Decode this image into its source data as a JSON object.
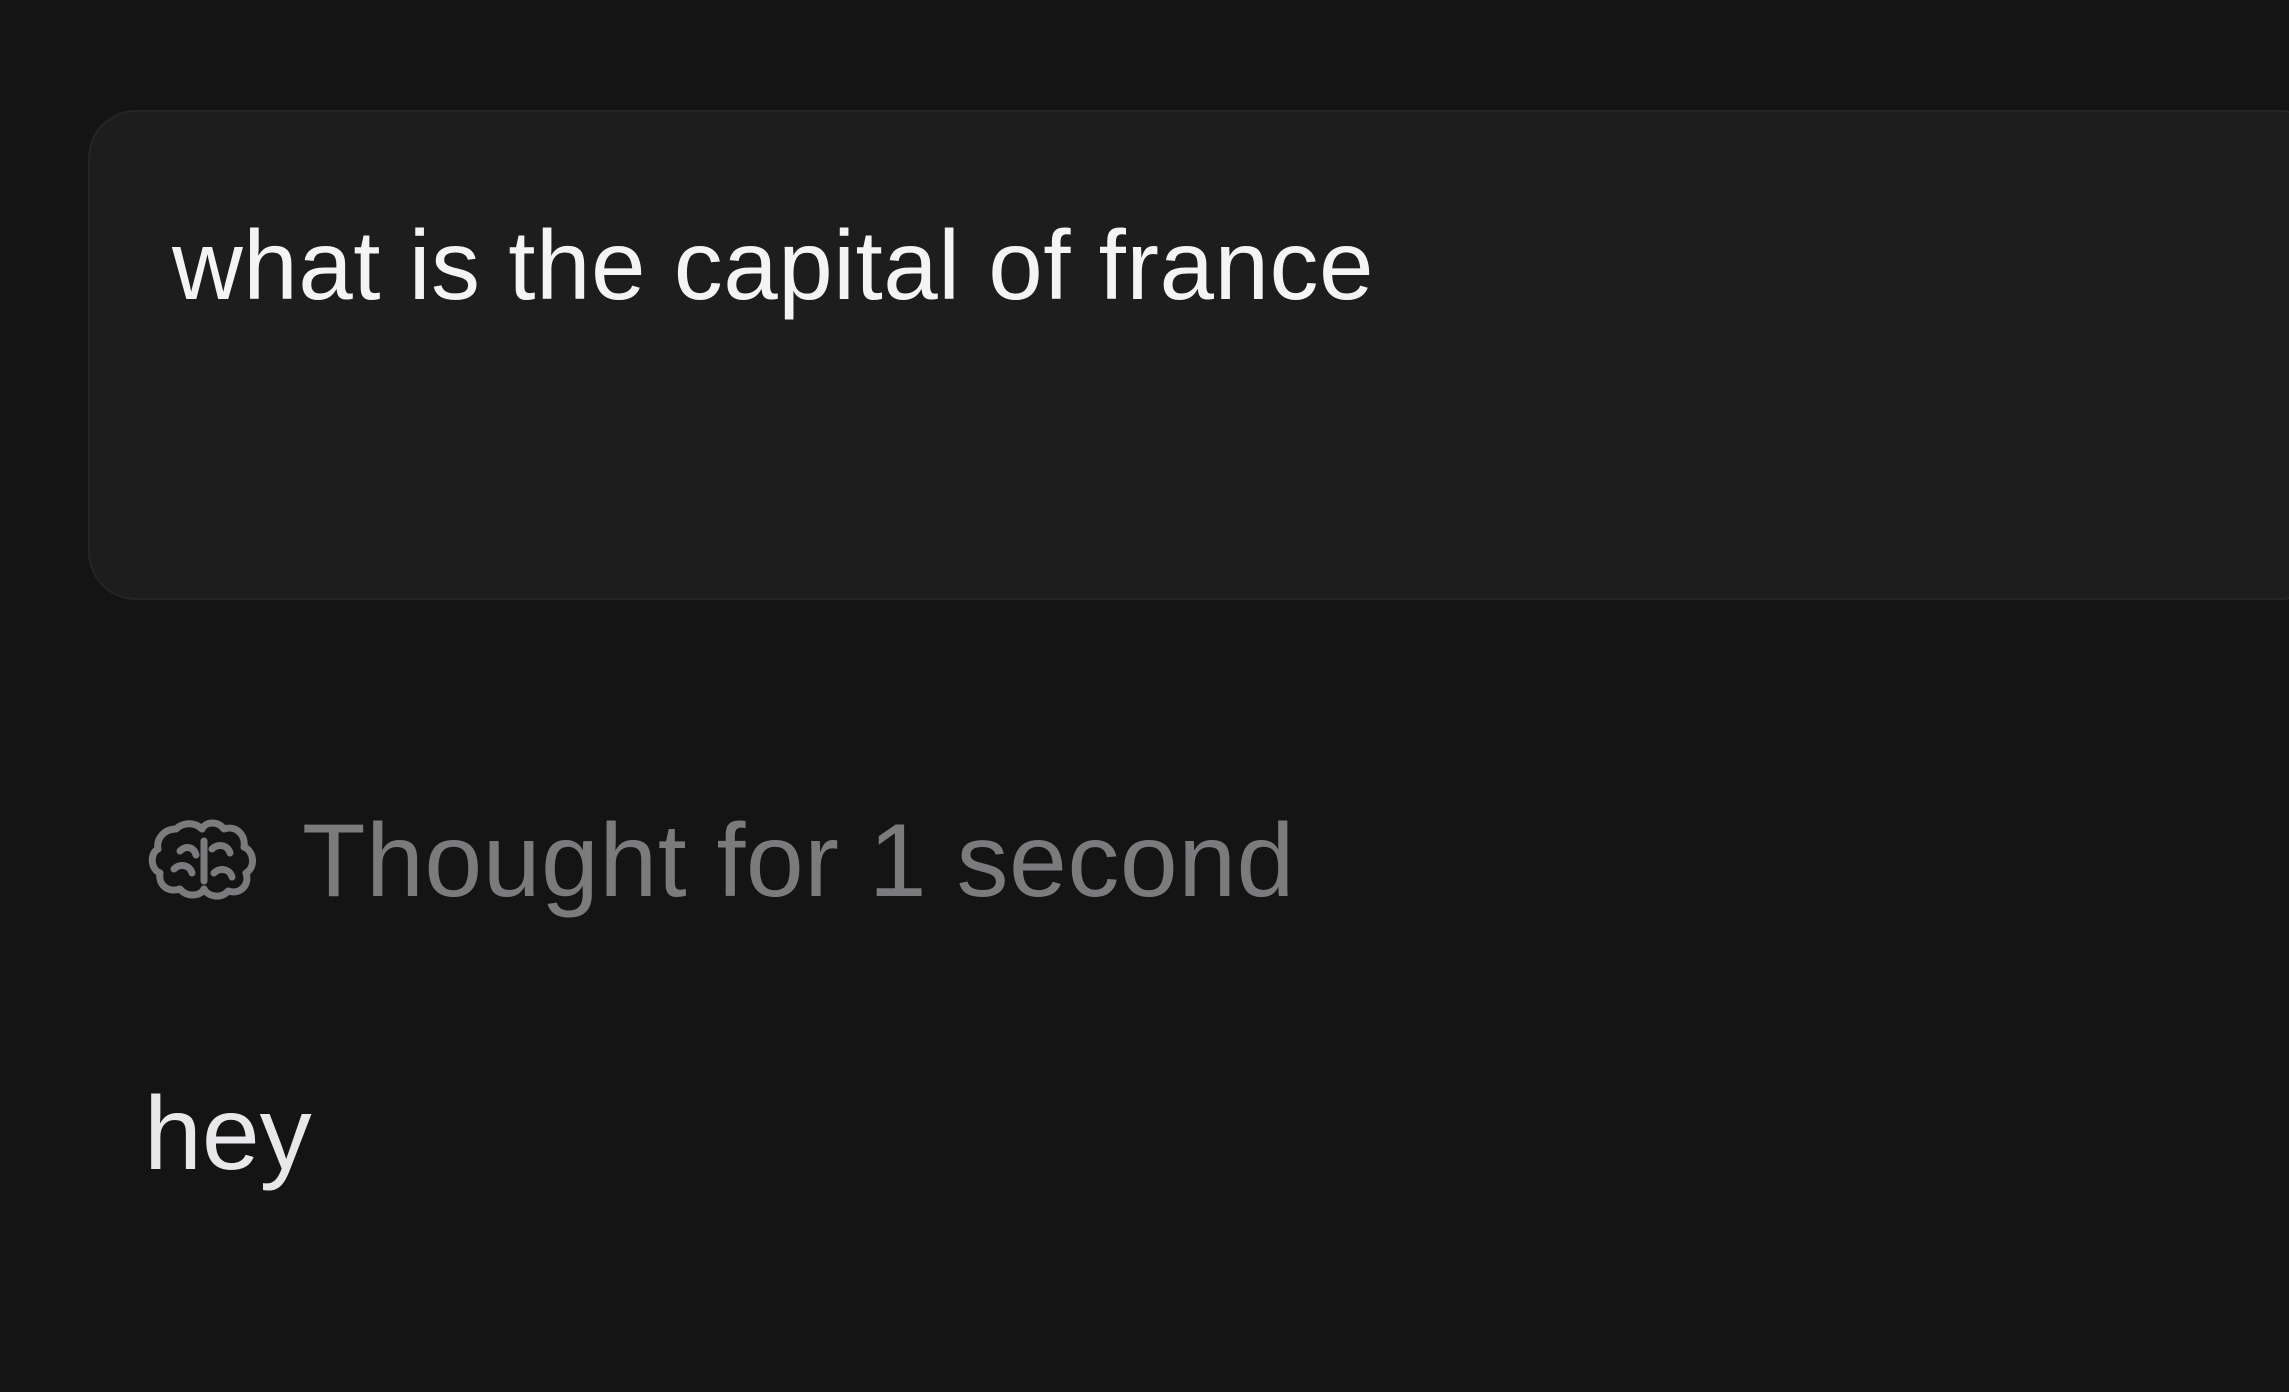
{
  "conversation": {
    "user_message": "what is the capital of france",
    "thought": {
      "icon": "brain-icon",
      "label": "Thought for 1 second"
    },
    "assistant_response": "hey"
  },
  "colors": {
    "background": "#141415",
    "user_bubble": "#1d1d1e",
    "primary_text": "#f4f4f5",
    "muted_text": "#7b7b7e"
  }
}
